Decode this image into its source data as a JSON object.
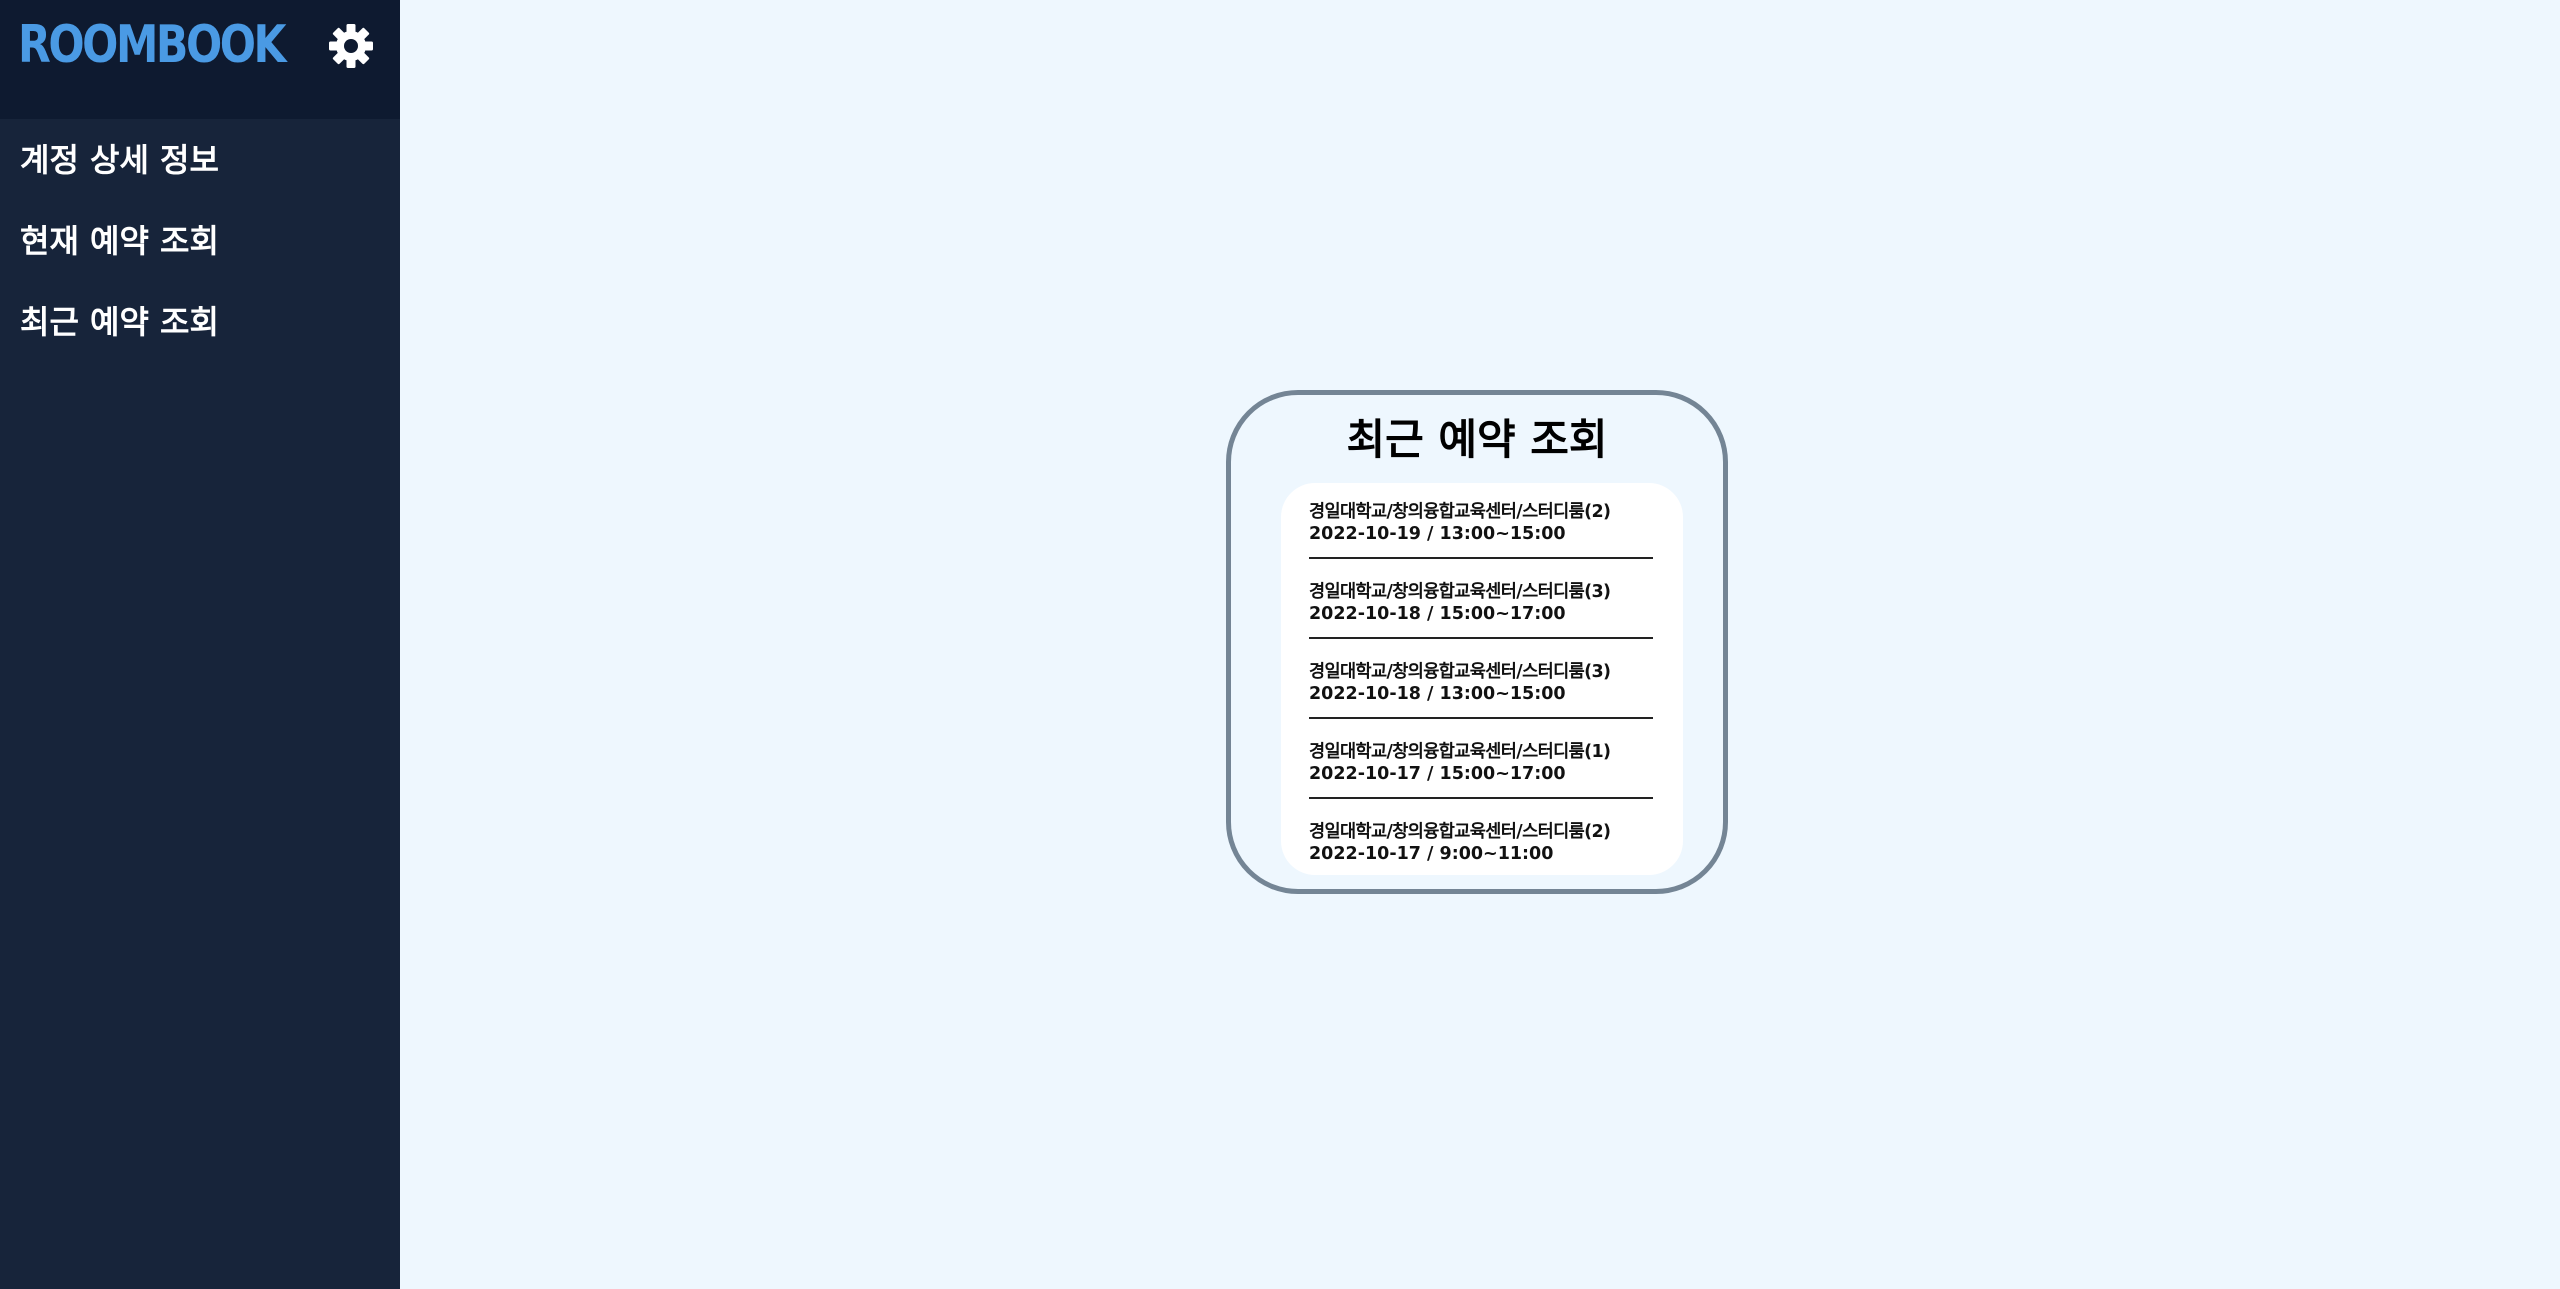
{
  "app": {
    "logo": "ROOMBOOK",
    "settings_icon": "gear-icon"
  },
  "sidebar": {
    "items": [
      {
        "label": "계정 상세 정보"
      },
      {
        "label": "현재 예약 조회"
      },
      {
        "label": "최근 예약 조회"
      }
    ]
  },
  "main": {
    "title": "최근 예약 조회",
    "reservations": [
      {
        "place": "경일대학교/창의융합교육센터/스터디룸(2)",
        "datetime": "2022-10-19 / 13:00~15:00"
      },
      {
        "place": "경일대학교/창의융합교육센터/스터디룸(3)",
        "datetime": "2022-10-18 / 15:00~17:00"
      },
      {
        "place": "경일대학교/창의융합교육센터/스터디룸(3)",
        "datetime": "2022-10-18 / 13:00~15:00"
      },
      {
        "place": "경일대학교/창의융합교육센터/스터디룸(1)",
        "datetime": "2022-10-17 / 15:00~17:00"
      },
      {
        "place": "경일대학교/창의융합교육센터/스터디룸(2)",
        "datetime": "2022-10-17 / 9:00~11:00"
      }
    ]
  },
  "colors": {
    "sidebar_bg": "#17243a",
    "sidebar_header_bg": "#0e1a30",
    "logo": "#4a9ae4",
    "page_bg": "#eef7fe",
    "card_border": "#748595"
  }
}
